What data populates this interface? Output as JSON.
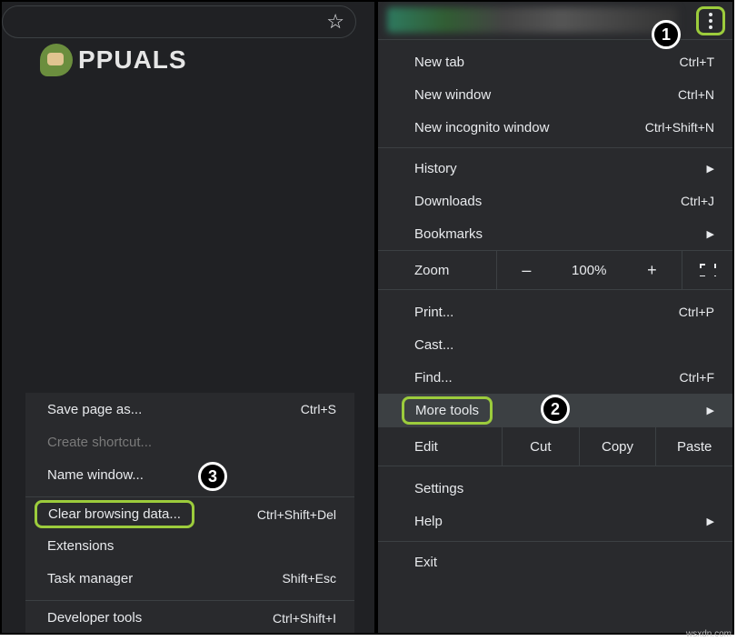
{
  "brand": {
    "name": "PPUALS"
  },
  "callouts": {
    "one": "1",
    "two": "2",
    "three": "3"
  },
  "main_menu": {
    "new_tab": {
      "label": "New tab",
      "shortcut": "Ctrl+T"
    },
    "new_window": {
      "label": "New window",
      "shortcut": "Ctrl+N"
    },
    "new_incognito": {
      "label": "New incognito window",
      "shortcut": "Ctrl+Shift+N"
    },
    "history": {
      "label": "History"
    },
    "downloads": {
      "label": "Downloads",
      "shortcut": "Ctrl+J"
    },
    "bookmarks": {
      "label": "Bookmarks"
    },
    "zoom": {
      "label": "Zoom",
      "minus": "–",
      "value": "100%",
      "plus": "+"
    },
    "print": {
      "label": "Print...",
      "shortcut": "Ctrl+P"
    },
    "cast": {
      "label": "Cast..."
    },
    "find": {
      "label": "Find...",
      "shortcut": "Ctrl+F"
    },
    "more_tools": {
      "label": "More tools"
    },
    "edit": {
      "label": "Edit",
      "cut": "Cut",
      "copy": "Copy",
      "paste": "Paste"
    },
    "settings": {
      "label": "Settings"
    },
    "help": {
      "label": "Help"
    },
    "exit": {
      "label": "Exit"
    }
  },
  "submenu": {
    "save_page": {
      "label": "Save page as...",
      "shortcut": "Ctrl+S"
    },
    "create_shortcut": {
      "label": "Create shortcut..."
    },
    "name_window": {
      "label": "Name window..."
    },
    "clear_browsing": {
      "label": "Clear browsing data...",
      "shortcut": "Ctrl+Shift+Del"
    },
    "extensions": {
      "label": "Extensions"
    },
    "task_manager": {
      "label": "Task manager",
      "shortcut": "Shift+Esc"
    },
    "developer_tools": {
      "label": "Developer tools",
      "shortcut": "Ctrl+Shift+I"
    }
  },
  "attrib": "wsxdn.com"
}
